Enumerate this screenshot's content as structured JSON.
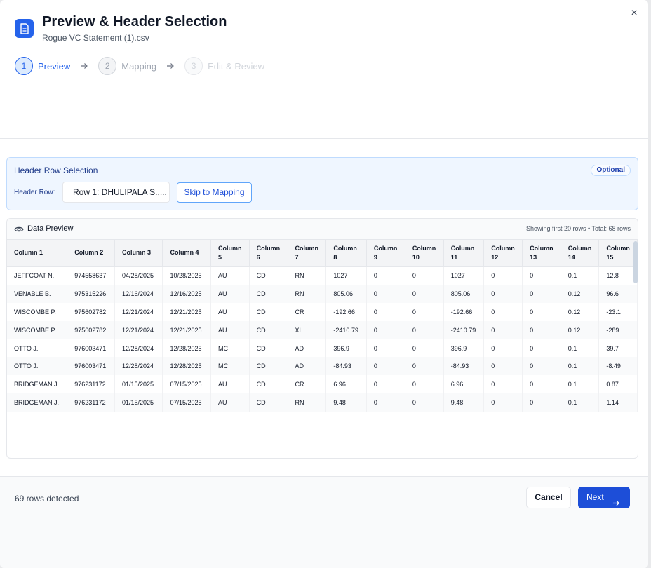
{
  "header": {
    "title": "Preview & Header Selection",
    "filename": "Rogue VC Statement (1).csv",
    "close_glyph": "×",
    "icon": "document-icon"
  },
  "steps": [
    {
      "number": "1",
      "label": "Preview",
      "state": "active"
    },
    {
      "number": "2",
      "label": "Mapping",
      "state": "upcoming"
    },
    {
      "number": "3",
      "label": "Edit & Review",
      "state": "upcoming"
    }
  ],
  "header_row_selection": {
    "title": "Header Row Selection",
    "badge": "Optional",
    "field_label": "Header Row:",
    "selected_value": "Row 1: DHULIPALA S.,...",
    "skip_label": "Skip to Mapping"
  },
  "data_preview": {
    "title": "Data Preview",
    "meta": "Showing first 20 rows • Total: 68 rows",
    "columns": [
      "Column 1",
      "Column 2",
      "Column 3",
      "Column 4",
      "Column 5",
      "Column 6",
      "Column 7",
      "Column 8",
      "Column 9",
      "Column 10",
      "Column 11",
      "Column 12",
      "Column 13",
      "Column 14",
      "Column 15"
    ],
    "rows": [
      [
        "JEFFCOAT N.",
        "974558637",
        "04/28/2025",
        "10/28/2025",
        "AU",
        "CD",
        "RN",
        "1027",
        "0",
        "0",
        "1027",
        "0",
        "0",
        "0.1",
        "12.8"
      ],
      [
        "VENABLE B.",
        "975315226",
        "12/16/2024",
        "12/16/2025",
        "AU",
        "CD",
        "RN",
        "805.06",
        "0",
        "0",
        "805.06",
        "0",
        "0",
        "0.12",
        "96.6"
      ],
      [
        "WISCOMBE P.",
        "975602782",
        "12/21/2024",
        "12/21/2025",
        "AU",
        "CD",
        "CR",
        "-192.66",
        "0",
        "0",
        "-192.66",
        "0",
        "0",
        "0.12",
        "-23.1"
      ],
      [
        "WISCOMBE P.",
        "975602782",
        "12/21/2024",
        "12/21/2025",
        "AU",
        "CD",
        "XL",
        "-2410.79",
        "0",
        "0",
        "-2410.79",
        "0",
        "0",
        "0.12",
        "-289"
      ],
      [
        "OTTO J.",
        "976003471",
        "12/28/2024",
        "12/28/2025",
        "MC",
        "CD",
        "AD",
        "396.9",
        "0",
        "0",
        "396.9",
        "0",
        "0",
        "0.1",
        "39.7"
      ],
      [
        "OTTO J.",
        "976003471",
        "12/28/2024",
        "12/28/2025",
        "MC",
        "CD",
        "AD",
        "-84.93",
        "0",
        "0",
        "-84.93",
        "0",
        "0",
        "0.1",
        "-8.49"
      ],
      [
        "BRIDGEMAN J.",
        "976231172",
        "01/15/2025",
        "07/15/2025",
        "AU",
        "CD",
        "CR",
        "6.96",
        "0",
        "0",
        "6.96",
        "0",
        "0",
        "0.1",
        "0.87"
      ],
      [
        "BRIDGEMAN J.",
        "976231172",
        "01/15/2025",
        "07/15/2025",
        "AU",
        "CD",
        "RN",
        "9.48",
        "0",
        "0",
        "9.48",
        "0",
        "0",
        "0.1",
        "1.14"
      ]
    ]
  },
  "footer": {
    "rows_detected": "69 rows detected",
    "cancel_label": "Cancel",
    "next_label": "Next"
  },
  "colors": {
    "accent": "#2563eb",
    "panel_bg": "#eff6ff"
  }
}
